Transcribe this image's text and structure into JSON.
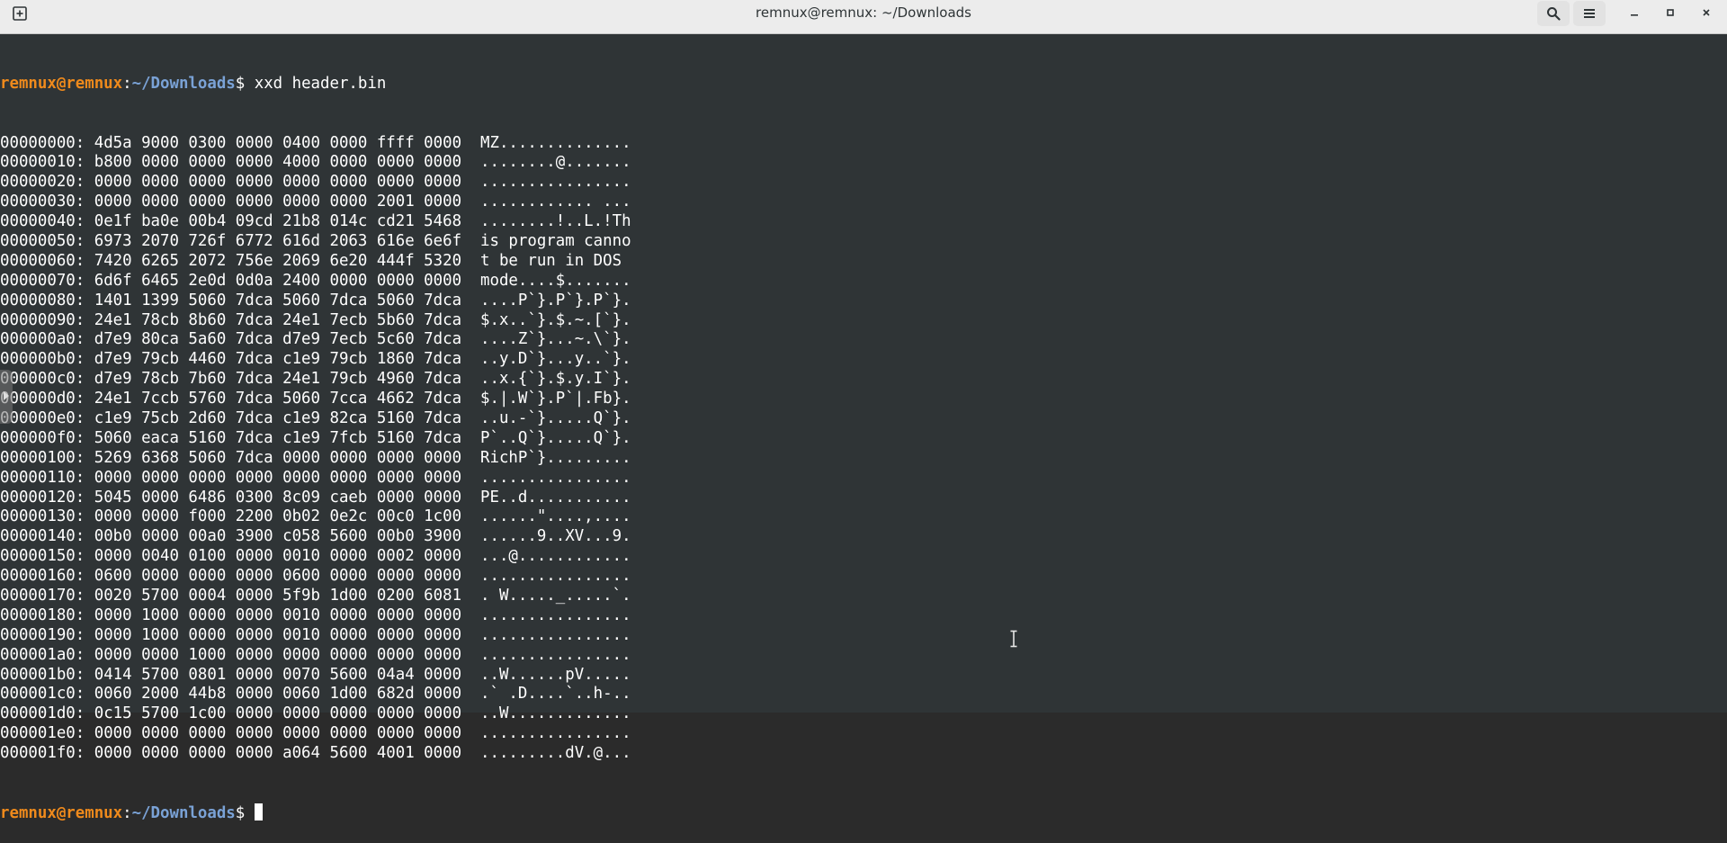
{
  "window": {
    "title": "remnux@remnux: ~/Downloads"
  },
  "icons": {
    "new_tab": "new-tab-icon",
    "search": "search-icon",
    "menu": "hamburger-menu-icon",
    "minimize": "minimize-icon",
    "maximize": "maximize-icon",
    "close": "close-icon"
  },
  "colors": {
    "prompt_user": "#ef8a1c",
    "prompt_path": "#7aa2d6",
    "terminal_bg": "#2f3436",
    "terminal_fg": "#ffffff"
  },
  "terminal": {
    "prompt_user": "remnux@remnux",
    "prompt_sep": ":",
    "prompt_path": "~/Downloads",
    "prompt_end": "$ ",
    "command": "xxd header.bin",
    "rows": [
      {
        "offset": "00000000:",
        "hex": "4d5a 9000 0300 0000 0400 0000 ffff 0000",
        "ascii": "MZ.............."
      },
      {
        "offset": "00000010:",
        "hex": "b800 0000 0000 0000 4000 0000 0000 0000",
        "ascii": "........@......."
      },
      {
        "offset": "00000020:",
        "hex": "0000 0000 0000 0000 0000 0000 0000 0000",
        "ascii": "................"
      },
      {
        "offset": "00000030:",
        "hex": "0000 0000 0000 0000 0000 0000 2001 0000",
        "ascii": "............ ..."
      },
      {
        "offset": "00000040:",
        "hex": "0e1f ba0e 00b4 09cd 21b8 014c cd21 5468",
        "ascii": "........!..L.!Th"
      },
      {
        "offset": "00000050:",
        "hex": "6973 2070 726f 6772 616d 2063 616e 6e6f",
        "ascii": "is program canno"
      },
      {
        "offset": "00000060:",
        "hex": "7420 6265 2072 756e 2069 6e20 444f 5320",
        "ascii": "t be run in DOS "
      },
      {
        "offset": "00000070:",
        "hex": "6d6f 6465 2e0d 0d0a 2400 0000 0000 0000",
        "ascii": "mode....$......."
      },
      {
        "offset": "00000080:",
        "hex": "1401 1399 5060 7dca 5060 7dca 5060 7dca",
        "ascii": "....P`}.P`}.P`}."
      },
      {
        "offset": "00000090:",
        "hex": "24e1 78cb 8b60 7dca 24e1 7ecb 5b60 7dca",
        "ascii": "$.x..`}.$.~.[`}."
      },
      {
        "offset": "000000a0:",
        "hex": "d7e9 80ca 5a60 7dca d7e9 7ecb 5c60 7dca",
        "ascii": "....Z`}...~.\\`}."
      },
      {
        "offset": "000000b0:",
        "hex": "d7e9 79cb 4460 7dca c1e9 79cb 1860 7dca",
        "ascii": "..y.D`}...y..`}."
      },
      {
        "offset": "000000c0:",
        "hex": "d7e9 78cb 7b60 7dca 24e1 79cb 4960 7dca",
        "ascii": "..x.{`}.$.y.I`}."
      },
      {
        "offset": "000000d0:",
        "hex": "24e1 7ccb 5760 7dca 5060 7cca 4662 7dca",
        "ascii": "$.|.W`}.P`|.Fb}."
      },
      {
        "offset": "000000e0:",
        "hex": "c1e9 75cb 2d60 7dca c1e9 82ca 5160 7dca",
        "ascii": "..u.-`}.....Q`}."
      },
      {
        "offset": "000000f0:",
        "hex": "5060 eaca 5160 7dca c1e9 7fcb 5160 7dca",
        "ascii": "P`..Q`}.....Q`}."
      },
      {
        "offset": "00000100:",
        "hex": "5269 6368 5060 7dca 0000 0000 0000 0000",
        "ascii": "RichP`}........."
      },
      {
        "offset": "00000110:",
        "hex": "0000 0000 0000 0000 0000 0000 0000 0000",
        "ascii": "................"
      },
      {
        "offset": "00000120:",
        "hex": "5045 0000 6486 0300 8c09 caeb 0000 0000",
        "ascii": "PE..d..........."
      },
      {
        "offset": "00000130:",
        "hex": "0000 0000 f000 2200 0b02 0e2c 00c0 1c00",
        "ascii": "......\"....,...."
      },
      {
        "offset": "00000140:",
        "hex": "00b0 0000 00a0 3900 c058 5600 00b0 3900",
        "ascii": "......9..XV...9."
      },
      {
        "offset": "00000150:",
        "hex": "0000 0040 0100 0000 0010 0000 0002 0000",
        "ascii": "...@............"
      },
      {
        "offset": "00000160:",
        "hex": "0600 0000 0000 0000 0600 0000 0000 0000",
        "ascii": "................"
      },
      {
        "offset": "00000170:",
        "hex": "0020 5700 0004 0000 5f9b 1d00 0200 6081",
        "ascii": ". W....._.....`."
      },
      {
        "offset": "00000180:",
        "hex": "0000 1000 0000 0000 0010 0000 0000 0000",
        "ascii": "................"
      },
      {
        "offset": "00000190:",
        "hex": "0000 1000 0000 0000 0010 0000 0000 0000",
        "ascii": "................"
      },
      {
        "offset": "000001a0:",
        "hex": "0000 0000 1000 0000 0000 0000 0000 0000",
        "ascii": "................"
      },
      {
        "offset": "000001b0:",
        "hex": "0414 5700 0801 0000 0070 5600 04a4 0000",
        "ascii": "..W......pV....."
      },
      {
        "offset": "000001c0:",
        "hex": "0060 2000 44b8 0000 0060 1d00 682d 0000",
        "ascii": ".` .D....`..h-.."
      },
      {
        "offset": "000001d0:",
        "hex": "0c15 5700 1c00 0000 0000 0000 0000 0000",
        "ascii": "..W............."
      },
      {
        "offset": "000001e0:",
        "hex": "0000 0000 0000 0000 0000 0000 0000 0000",
        "ascii": "................"
      },
      {
        "offset": "000001f0:",
        "hex": "0000 0000 0000 0000 a064 5600 4001 0000",
        "ascii": ".........dV.@..."
      }
    ]
  }
}
